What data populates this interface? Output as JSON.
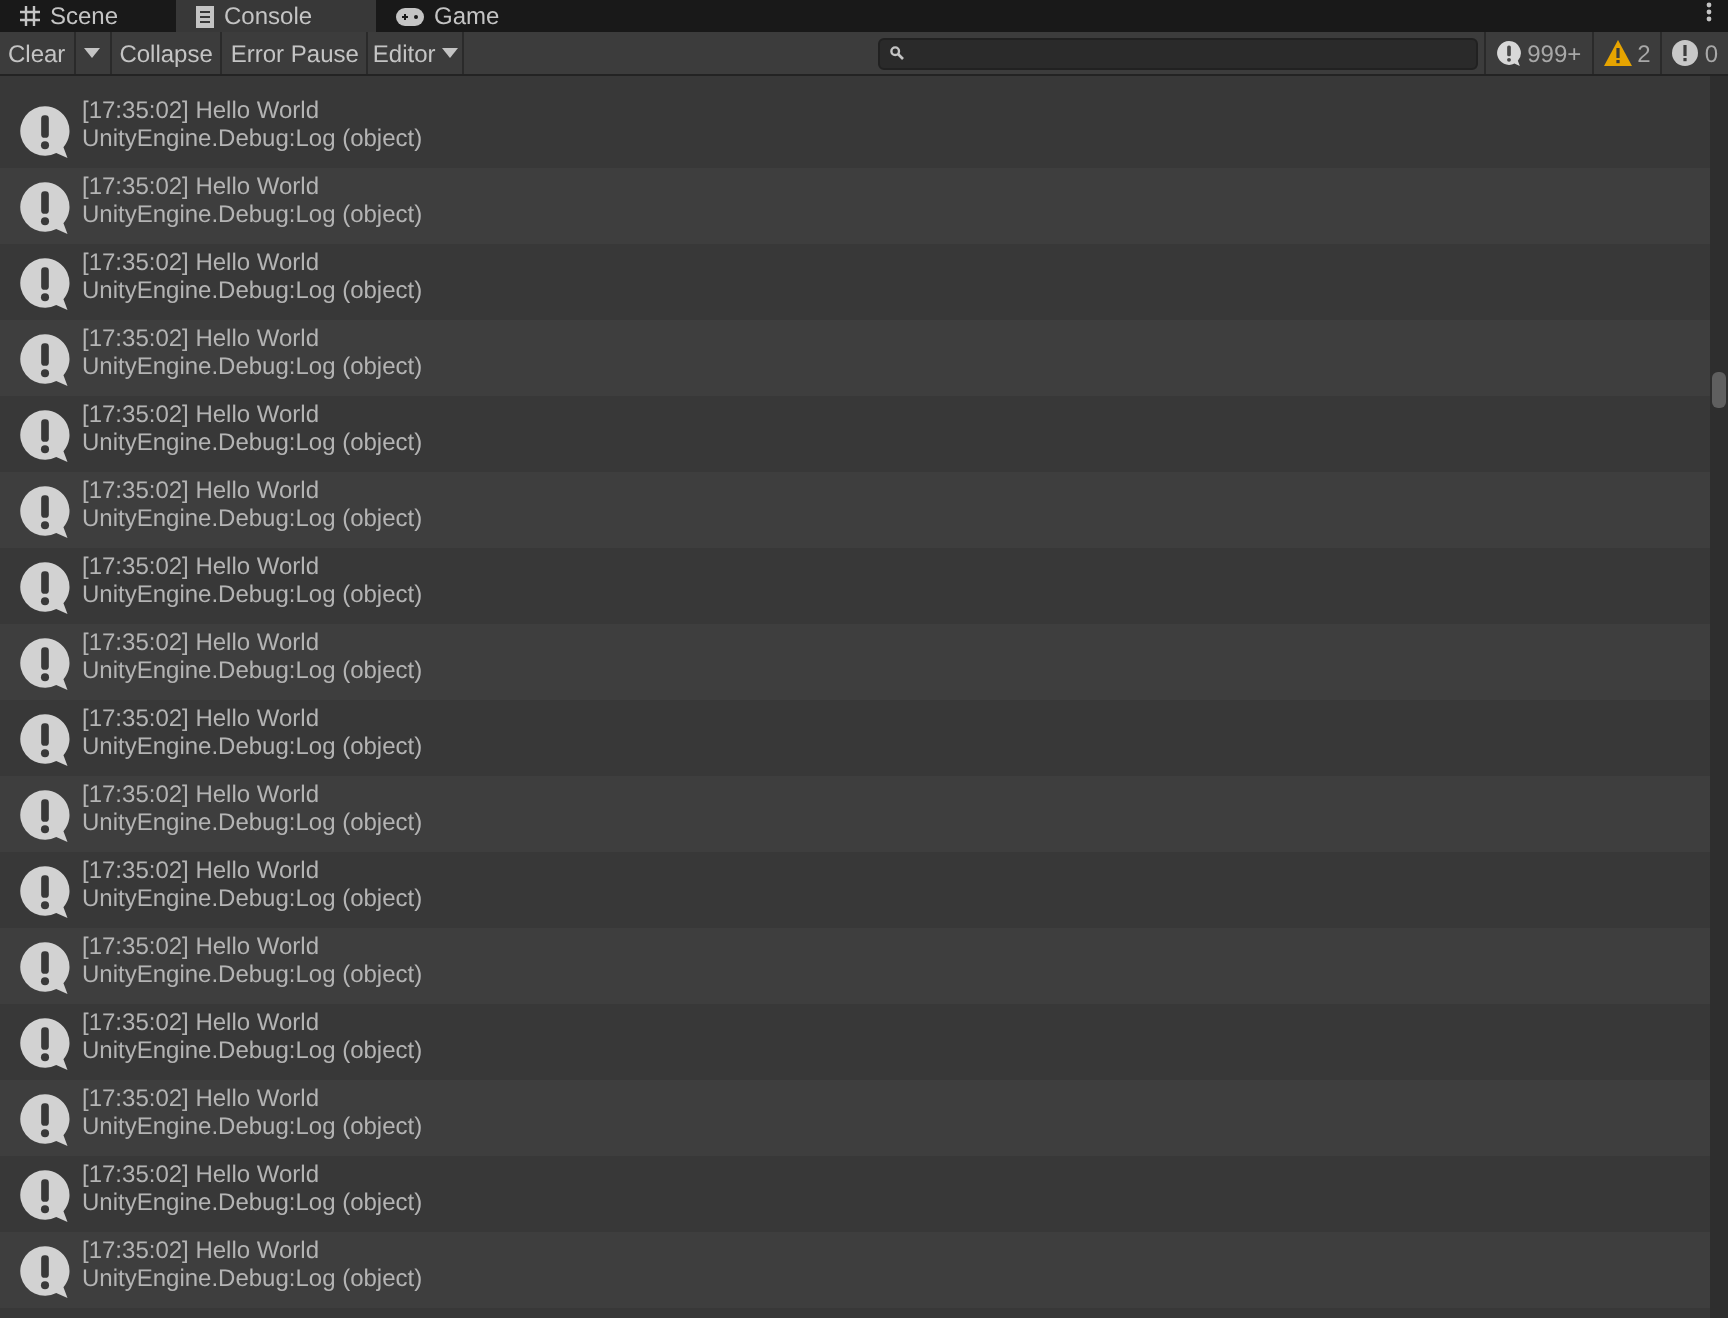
{
  "tabs": [
    {
      "label": "Scene",
      "kind": "grid",
      "selected": false
    },
    {
      "label": "Console",
      "kind": "list",
      "selected": true
    },
    {
      "label": "Game",
      "kind": "gamepad",
      "selected": false
    }
  ],
  "toolbar": {
    "clear": "Clear",
    "collapse": "Collapse",
    "error_pause": "Error Pause",
    "editor": "Editor"
  },
  "counters": [
    {
      "kind": "log",
      "count": "999+"
    },
    {
      "kind": "warning",
      "count": "2"
    },
    {
      "kind": "error",
      "count": "0"
    }
  ],
  "entries": [
    {
      "message": "[17:35:02] Hello World",
      "source": "UnityEngine.Debug:Log (object)"
    },
    {
      "message": "[17:35:02] Hello World",
      "source": "UnityEngine.Debug:Log (object)"
    },
    {
      "message": "[17:35:02] Hello World",
      "source": "UnityEngine.Debug:Log (object)"
    },
    {
      "message": "[17:35:02] Hello World",
      "source": "UnityEngine.Debug:Log (object)"
    },
    {
      "message": "[17:35:02] Hello World",
      "source": "UnityEngine.Debug:Log (object)"
    },
    {
      "message": "[17:35:02] Hello World",
      "source": "UnityEngine.Debug:Log (object)"
    },
    {
      "message": "[17:35:02] Hello World",
      "source": "UnityEngine.Debug:Log (object)"
    },
    {
      "message": "[17:35:02] Hello World",
      "source": "UnityEngine.Debug:Log (object)"
    },
    {
      "message": "[17:35:02] Hello World",
      "source": "UnityEngine.Debug:Log (object)"
    },
    {
      "message": "[17:35:02] Hello World",
      "source": "UnityEngine.Debug:Log (object)"
    },
    {
      "message": "[17:35:02] Hello World",
      "source": "UnityEngine.Debug:Log (object)"
    },
    {
      "message": "[17:35:02] Hello World",
      "source": "UnityEngine.Debug:Log (object)"
    },
    {
      "message": "[17:35:02] Hello World",
      "source": "UnityEngine.Debug:Log (object)"
    },
    {
      "message": "[17:35:02] Hello World",
      "source": "UnityEngine.Debug:Log (object)"
    },
    {
      "message": "[17:35:02] Hello World",
      "source": "UnityEngine.Debug:Log (object)"
    },
    {
      "message": "[17:35:02] Hello World",
      "source": "UnityEngine.Debug:Log (object)"
    }
  ]
}
